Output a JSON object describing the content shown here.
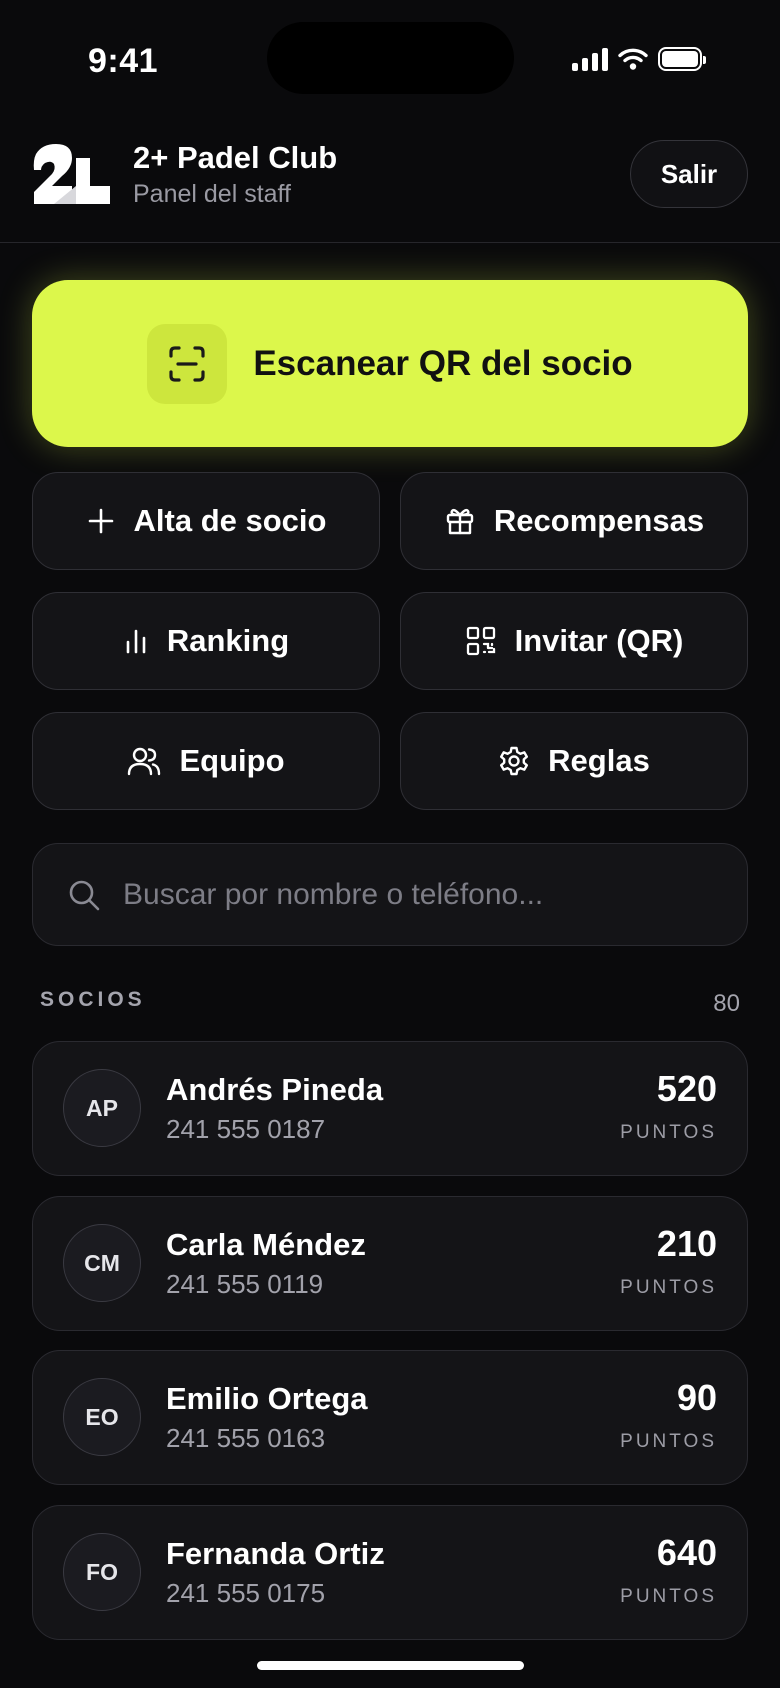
{
  "status_bar": {
    "time": "9:41"
  },
  "header": {
    "club_name": "2+ Padel Club",
    "subtitle": "Panel del staff",
    "exit_label": "Salir",
    "logo_text": "2+"
  },
  "scan": {
    "label": "Escanear QR del socio",
    "icon": "qr-scan-icon"
  },
  "actions": [
    {
      "label": "Alta de socio",
      "icon": "plus-icon"
    },
    {
      "label": "Recompensas",
      "icon": "gift-icon"
    },
    {
      "label": "Ranking",
      "icon": "bar-chart-icon"
    },
    {
      "label": "Invitar (QR)",
      "icon": "qr-code-icon"
    },
    {
      "label": "Equipo",
      "icon": "users-icon"
    },
    {
      "label": "Reglas",
      "icon": "gear-icon"
    }
  ],
  "search": {
    "placeholder": "Buscar por nombre o teléfono..."
  },
  "members_section": {
    "title": "SOCIOS",
    "count": "80"
  },
  "members": [
    {
      "initials": "AP",
      "name": "Andrés Pineda",
      "phone": "241 555 0187",
      "points": "520",
      "points_label": "PUNTOS"
    },
    {
      "initials": "CM",
      "name": "Carla Méndez",
      "phone": "241 555 0119",
      "points": "210",
      "points_label": "PUNTOS"
    },
    {
      "initials": "EO",
      "name": "Emilio Ortega",
      "phone": "241 555 0163",
      "points": "90",
      "points_label": "PUNTOS"
    },
    {
      "initials": "FO",
      "name": "Fernanda Ortiz",
      "phone": "241 555 0175",
      "points": "640",
      "points_label": "PUNTOS"
    }
  ],
  "colors": {
    "background": "#0a0a0c",
    "accent": "#dcf74b",
    "card": "#141417",
    "muted_text": "#9a9aa3"
  }
}
